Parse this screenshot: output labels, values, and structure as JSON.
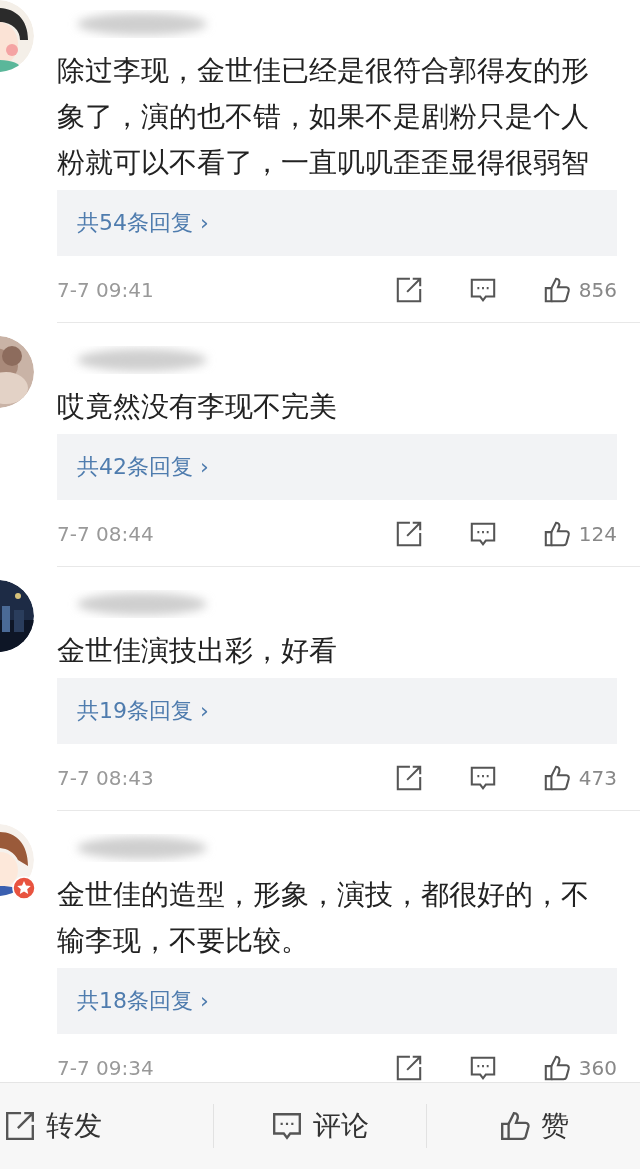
{
  "comments": [
    {
      "badge": false,
      "text": "除过李现，金世佳已经是很符合郭得友的形象了，演的也不错，如果不是剧粉只是个人粉就可以不看了，一直叽叽歪歪显得很弱智",
      "replies": "共54条回复",
      "chevron": "›",
      "time": "7-7 09:41",
      "likes": "856"
    },
    {
      "badge": false,
      "text": "哎竟然没有李现不完美",
      "replies": "共42条回复",
      "chevron": "›",
      "time": "7-7 08:44",
      "likes": "124"
    },
    {
      "badge": false,
      "text": "金世佳演技出彩，好看",
      "replies": "共19条回复",
      "chevron": "›",
      "time": "7-7 08:43",
      "likes": "473"
    },
    {
      "badge": true,
      "text": "金世佳的造型，形象，演技，都很好的，不输李现，不要比较。",
      "replies": "共18条回复",
      "chevron": "›",
      "time": "7-7 09:34",
      "likes": "360"
    }
  ],
  "bottom_bar": [
    {
      "kind": "repost",
      "label": "转发"
    },
    {
      "kind": "comment",
      "label": "评论"
    },
    {
      "kind": "like",
      "label": "赞"
    }
  ]
}
